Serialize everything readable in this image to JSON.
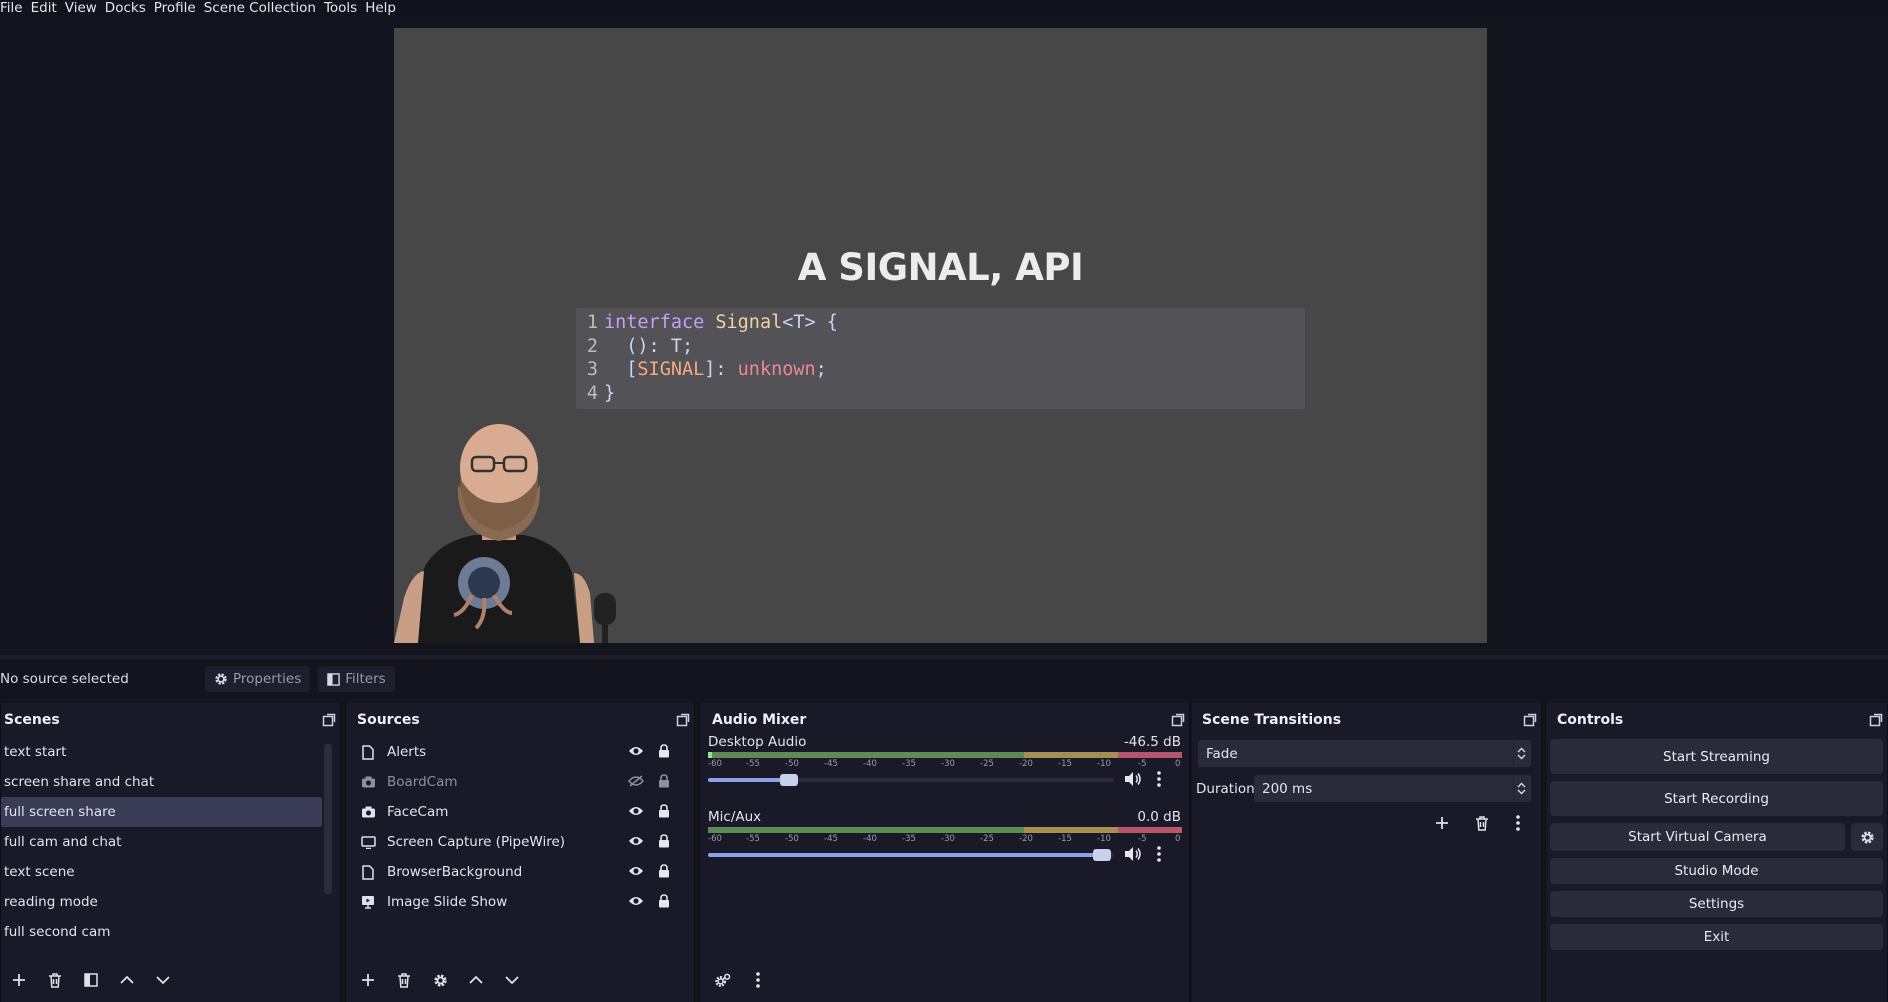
{
  "menu": [
    "File",
    "Edit",
    "View",
    "Docks",
    "Profile",
    "Scene Collection",
    "Tools",
    "Help"
  ],
  "preview": {
    "slide_title": "A SIGNAL, API",
    "code_line_numbers": [
      "1",
      "2",
      "3",
      "4"
    ],
    "code": {
      "l1_kw": "interface",
      "l1_type": "Signal",
      "l1_rest": "<T> {",
      "l2": "  (): T;",
      "l3_open": "  [",
      "l3_key": "SIGNAL",
      "l3_mid": "]: ",
      "l3_type": "unknown",
      "l3_end": ";",
      "l4": "}"
    }
  },
  "source_toolbar": {
    "status": "No source selected",
    "properties": "Properties",
    "filters": "Filters"
  },
  "scenes": {
    "title": "Scenes",
    "items": [
      "text start",
      "screen share and chat",
      "full screen share",
      "full cam and chat",
      "text scene",
      "reading mode",
      "full second cam"
    ],
    "selected": "full screen share"
  },
  "sources": {
    "title": "Sources",
    "items": [
      {
        "name": "Alerts",
        "icon": "file-icon",
        "visible": true
      },
      {
        "name": "BoardCam",
        "icon": "camera-icon",
        "visible": false
      },
      {
        "name": "FaceCam",
        "icon": "camera-icon",
        "visible": true
      },
      {
        "name": "Screen Capture (PipeWire)",
        "icon": "monitor-icon",
        "visible": true
      },
      {
        "name": "BrowserBackground",
        "icon": "file-icon",
        "visible": true
      },
      {
        "name": "Image Slide Show",
        "icon": "slideshow-icon",
        "visible": true
      }
    ]
  },
  "mixer": {
    "title": "Audio Mixer",
    "ticks": [
      "-60",
      "-55",
      "-50",
      "-45",
      "-40",
      "-35",
      "-30",
      "-25",
      "-20",
      "-15",
      "-10",
      "-5",
      "0"
    ],
    "channels": [
      {
        "name": "Desktop Audio",
        "db": "-46.5 dB",
        "volume": 0.2
      },
      {
        "name": "Mic/Aux",
        "db": "0.0 dB",
        "volume": 0.97
      }
    ]
  },
  "transitions": {
    "title": "Scene Transitions",
    "selected": "Fade",
    "duration_label": "Duration",
    "duration_value": "200 ms"
  },
  "controls": {
    "title": "Controls",
    "start_streaming": "Start Streaming",
    "start_recording": "Start Recording",
    "start_virtual_camera": "Start Virtual Camera",
    "studio_mode": "Studio Mode",
    "settings": "Settings",
    "exit": "Exit"
  },
  "colors": {
    "background": "#14141f",
    "dock": "#191927",
    "selection": "#3a3b55",
    "button": "#2a2a3b",
    "accent": "#8aa2e8"
  }
}
